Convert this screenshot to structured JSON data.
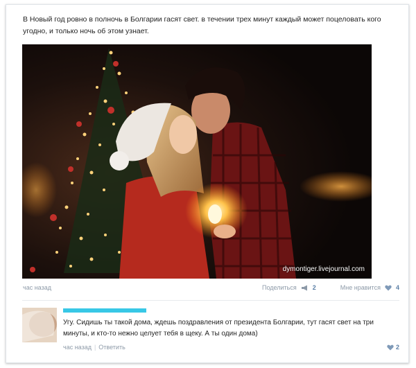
{
  "post": {
    "text": "В Новый год ровно в полночь в Болгарии гасят свет. в течении трех минут каждый может поцеловать кого угодно, и только ночь об этом узнает.",
    "image_alt_icon": "photo-couple-kissing-by-christmas-tree",
    "watermark": "dymontiger.livejournal.com",
    "time": "час назад",
    "share_label": "Поделиться",
    "share_icon": "megaphone-icon",
    "share_count": "2",
    "like_label": "Мне нравится",
    "like_icon": "heart-icon",
    "like_count": "4"
  },
  "comment": {
    "author_redacted_color": "#38c8e6",
    "text": "Угу. Сидишь ты такой дома, ждешь поздравления от президента Болгарии, тут гасят свет на три минуты, и кто-то нежно целует тебя в щеку. А ты один дома)",
    "time": "час назад",
    "separator": "|",
    "reply_label": "Ответить",
    "like_icon": "heart-icon",
    "like_count": "2"
  },
  "colors": {
    "meta_text": "#8d9aa8",
    "link_blue": "#5b7fa6",
    "heart": "#7f9ab8"
  }
}
